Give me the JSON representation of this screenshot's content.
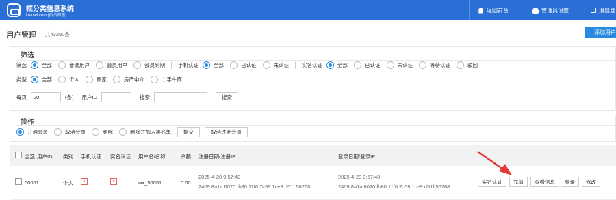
{
  "header": {
    "brand_title": "框分类信息系统",
    "brand_sub": "kfenlei.com [后台面板]",
    "nav": [
      {
        "label": "返回前台",
        "icon": "home-icon"
      },
      {
        "label": "管理员设置",
        "icon": "user-icon"
      },
      {
        "label": "退出登",
        "icon": "logout-icon"
      }
    ]
  },
  "page": {
    "title": "用户管理",
    "count": "共43290条",
    "add_button": "添加用户"
  },
  "filter": {
    "title": "筛选",
    "row1": {
      "label_filter": "筛选",
      "filter_options": [
        "全部",
        "普通用户",
        "会员用户",
        "会员到期"
      ],
      "label_phone": "手机认证",
      "phone_options": [
        "全部",
        "已认证",
        "未认证"
      ],
      "label_realname": "实名认证",
      "realname_options": [
        "全部",
        "已认证",
        "未认证",
        "等待认证",
        "驳回"
      ]
    },
    "row2": {
      "label_type": "类型",
      "type_options": [
        "全部",
        "个人",
        "商家",
        "房产中介",
        "二手车商"
      ]
    },
    "row3": {
      "per_page_label": "每页",
      "per_page_value": "20",
      "per_page_unit": "(条)",
      "userid_label": "用户ID",
      "userid_value": "",
      "search_label": "搜索",
      "search_value": "",
      "search_button": "搜索"
    }
  },
  "operation": {
    "title": "操作",
    "options": [
      "开通会员",
      "取消会员",
      "删除",
      "删除并加入黑名单"
    ],
    "submit_button": "提交",
    "cancel_expired_button": "取消过期会员"
  },
  "table": {
    "headers": {
      "select_all": "全选",
      "user_id": "用户ID",
      "category": "类别",
      "phone_verified": "手机认证",
      "realname_verified": "实名认证",
      "username": "用户名/名称",
      "balance": "余额",
      "register": "注册日期/注册IP",
      "login": "登录日期/登录IP"
    },
    "rows": [
      {
        "user_id": "50051",
        "category": "个人",
        "username": "wx_50051",
        "balance": "0.00",
        "register_date": "2025-4-20 9:57:40",
        "register_ip": "2409:8a1a:6020:fb80:11f6:7c59:1ce9:d51f:56268",
        "login_date": "2025-4-20 9:57:40",
        "login_ip": "2409:8a1a:6020:fb80:11f6:7c59:1ce9:d51f:56268",
        "actions": [
          "实名认证",
          "充值",
          "查看信息",
          "登录",
          "修改"
        ]
      }
    ]
  },
  "colors": {
    "topbar": "#2a6fd6",
    "accent": "#2a8ae0",
    "annotation_arrow": "#e53935"
  }
}
